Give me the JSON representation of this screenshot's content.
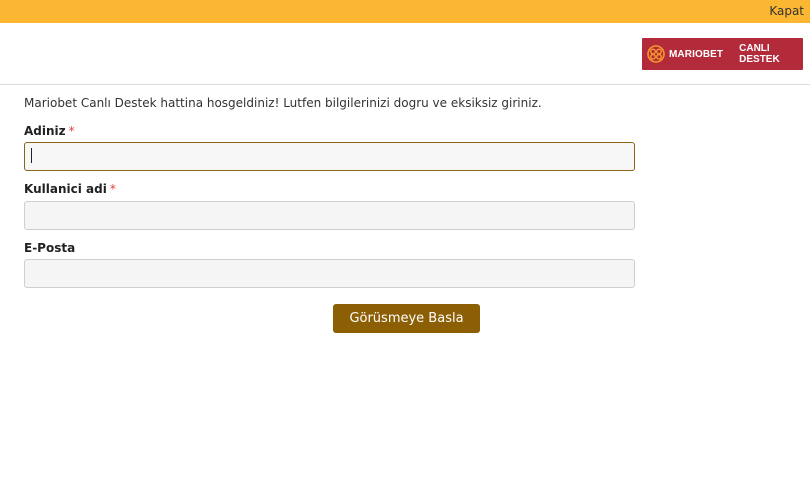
{
  "topbar": {
    "close_label": "Kapat",
    "color": "#fbb731"
  },
  "logo": {
    "brand": "MARIOBET",
    "subtitle": "CANLI DESTEK",
    "background_color": "#b32a3a"
  },
  "intro_text": "Mariobet Canlı Destek hattina hosgeldiniz! Lutfen bilgilerinizi dogru ve eksiksiz giriniz.",
  "form": {
    "fields": [
      {
        "label": "Adiniz",
        "required": true,
        "value": ""
      },
      {
        "label": "Kullanici adi",
        "required": true,
        "value": ""
      },
      {
        "label": "E-Posta",
        "required": false,
        "value": ""
      }
    ],
    "required_marker": "*",
    "submit_label": "Görüsmeye Basla",
    "submit_color": "#8d5f05"
  }
}
